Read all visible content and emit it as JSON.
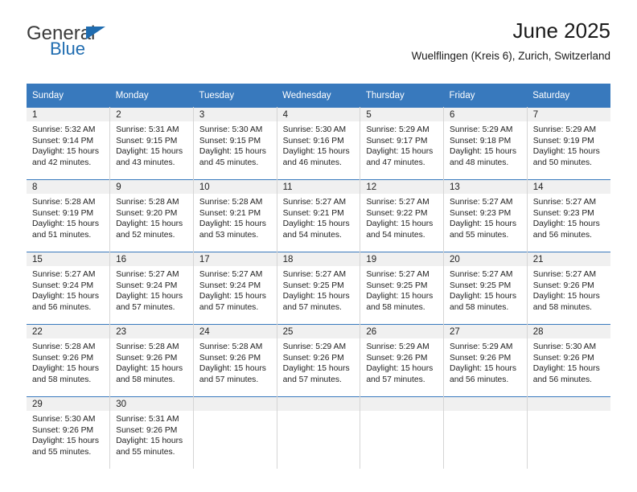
{
  "brand": {
    "name_top": "General",
    "name_bottom": "Blue"
  },
  "header": {
    "title": "June 2025",
    "subtitle": "Wuelflingen (Kreis 6), Zurich, Switzerland"
  },
  "colors": {
    "header_blue": "#3879bd",
    "brand_blue": "#1f6cb0",
    "daynum_band": "#f0f0f0",
    "cell_border": "#d5d5d5"
  },
  "calendar": {
    "weekday_headers": [
      "Sunday",
      "Monday",
      "Tuesday",
      "Wednesday",
      "Thursday",
      "Friday",
      "Saturday"
    ],
    "weeks": [
      [
        {
          "day": "1",
          "sunrise": "Sunrise: 5:32 AM",
          "sunset": "Sunset: 9:14 PM",
          "daylight": "Daylight: 15 hours and 42 minutes."
        },
        {
          "day": "2",
          "sunrise": "Sunrise: 5:31 AM",
          "sunset": "Sunset: 9:15 PM",
          "daylight": "Daylight: 15 hours and 43 minutes."
        },
        {
          "day": "3",
          "sunrise": "Sunrise: 5:30 AM",
          "sunset": "Sunset: 9:15 PM",
          "daylight": "Daylight: 15 hours and 45 minutes."
        },
        {
          "day": "4",
          "sunrise": "Sunrise: 5:30 AM",
          "sunset": "Sunset: 9:16 PM",
          "daylight": "Daylight: 15 hours and 46 minutes."
        },
        {
          "day": "5",
          "sunrise": "Sunrise: 5:29 AM",
          "sunset": "Sunset: 9:17 PM",
          "daylight": "Daylight: 15 hours and 47 minutes."
        },
        {
          "day": "6",
          "sunrise": "Sunrise: 5:29 AM",
          "sunset": "Sunset: 9:18 PM",
          "daylight": "Daylight: 15 hours and 48 minutes."
        },
        {
          "day": "7",
          "sunrise": "Sunrise: 5:29 AM",
          "sunset": "Sunset: 9:19 PM",
          "daylight": "Daylight: 15 hours and 50 minutes."
        }
      ],
      [
        {
          "day": "8",
          "sunrise": "Sunrise: 5:28 AM",
          "sunset": "Sunset: 9:19 PM",
          "daylight": "Daylight: 15 hours and 51 minutes."
        },
        {
          "day": "9",
          "sunrise": "Sunrise: 5:28 AM",
          "sunset": "Sunset: 9:20 PM",
          "daylight": "Daylight: 15 hours and 52 minutes."
        },
        {
          "day": "10",
          "sunrise": "Sunrise: 5:28 AM",
          "sunset": "Sunset: 9:21 PM",
          "daylight": "Daylight: 15 hours and 53 minutes."
        },
        {
          "day": "11",
          "sunrise": "Sunrise: 5:27 AM",
          "sunset": "Sunset: 9:21 PM",
          "daylight": "Daylight: 15 hours and 54 minutes."
        },
        {
          "day": "12",
          "sunrise": "Sunrise: 5:27 AM",
          "sunset": "Sunset: 9:22 PM",
          "daylight": "Daylight: 15 hours and 54 minutes."
        },
        {
          "day": "13",
          "sunrise": "Sunrise: 5:27 AM",
          "sunset": "Sunset: 9:23 PM",
          "daylight": "Daylight: 15 hours and 55 minutes."
        },
        {
          "day": "14",
          "sunrise": "Sunrise: 5:27 AM",
          "sunset": "Sunset: 9:23 PM",
          "daylight": "Daylight: 15 hours and 56 minutes."
        }
      ],
      [
        {
          "day": "15",
          "sunrise": "Sunrise: 5:27 AM",
          "sunset": "Sunset: 9:24 PM",
          "daylight": "Daylight: 15 hours and 56 minutes."
        },
        {
          "day": "16",
          "sunrise": "Sunrise: 5:27 AM",
          "sunset": "Sunset: 9:24 PM",
          "daylight": "Daylight: 15 hours and 57 minutes."
        },
        {
          "day": "17",
          "sunrise": "Sunrise: 5:27 AM",
          "sunset": "Sunset: 9:24 PM",
          "daylight": "Daylight: 15 hours and 57 minutes."
        },
        {
          "day": "18",
          "sunrise": "Sunrise: 5:27 AM",
          "sunset": "Sunset: 9:25 PM",
          "daylight": "Daylight: 15 hours and 57 minutes."
        },
        {
          "day": "19",
          "sunrise": "Sunrise: 5:27 AM",
          "sunset": "Sunset: 9:25 PM",
          "daylight": "Daylight: 15 hours and 58 minutes."
        },
        {
          "day": "20",
          "sunrise": "Sunrise: 5:27 AM",
          "sunset": "Sunset: 9:25 PM",
          "daylight": "Daylight: 15 hours and 58 minutes."
        },
        {
          "day": "21",
          "sunrise": "Sunrise: 5:27 AM",
          "sunset": "Sunset: 9:26 PM",
          "daylight": "Daylight: 15 hours and 58 minutes."
        }
      ],
      [
        {
          "day": "22",
          "sunrise": "Sunrise: 5:28 AM",
          "sunset": "Sunset: 9:26 PM",
          "daylight": "Daylight: 15 hours and 58 minutes."
        },
        {
          "day": "23",
          "sunrise": "Sunrise: 5:28 AM",
          "sunset": "Sunset: 9:26 PM",
          "daylight": "Daylight: 15 hours and 58 minutes."
        },
        {
          "day": "24",
          "sunrise": "Sunrise: 5:28 AM",
          "sunset": "Sunset: 9:26 PM",
          "daylight": "Daylight: 15 hours and 57 minutes."
        },
        {
          "day": "25",
          "sunrise": "Sunrise: 5:29 AM",
          "sunset": "Sunset: 9:26 PM",
          "daylight": "Daylight: 15 hours and 57 minutes."
        },
        {
          "day": "26",
          "sunrise": "Sunrise: 5:29 AM",
          "sunset": "Sunset: 9:26 PM",
          "daylight": "Daylight: 15 hours and 57 minutes."
        },
        {
          "day": "27",
          "sunrise": "Sunrise: 5:29 AM",
          "sunset": "Sunset: 9:26 PM",
          "daylight": "Daylight: 15 hours and 56 minutes."
        },
        {
          "day": "28",
          "sunrise": "Sunrise: 5:30 AM",
          "sunset": "Sunset: 9:26 PM",
          "daylight": "Daylight: 15 hours and 56 minutes."
        }
      ],
      [
        {
          "day": "29",
          "sunrise": "Sunrise: 5:30 AM",
          "sunset": "Sunset: 9:26 PM",
          "daylight": "Daylight: 15 hours and 55 minutes."
        },
        {
          "day": "30",
          "sunrise": "Sunrise: 5:31 AM",
          "sunset": "Sunset: 9:26 PM",
          "daylight": "Daylight: 15 hours and 55 minutes."
        },
        {
          "day": "",
          "sunrise": "",
          "sunset": "",
          "daylight": ""
        },
        {
          "day": "",
          "sunrise": "",
          "sunset": "",
          "daylight": ""
        },
        {
          "day": "",
          "sunrise": "",
          "sunset": "",
          "daylight": ""
        },
        {
          "day": "",
          "sunrise": "",
          "sunset": "",
          "daylight": ""
        },
        {
          "day": "",
          "sunrise": "",
          "sunset": "",
          "daylight": ""
        }
      ]
    ]
  }
}
